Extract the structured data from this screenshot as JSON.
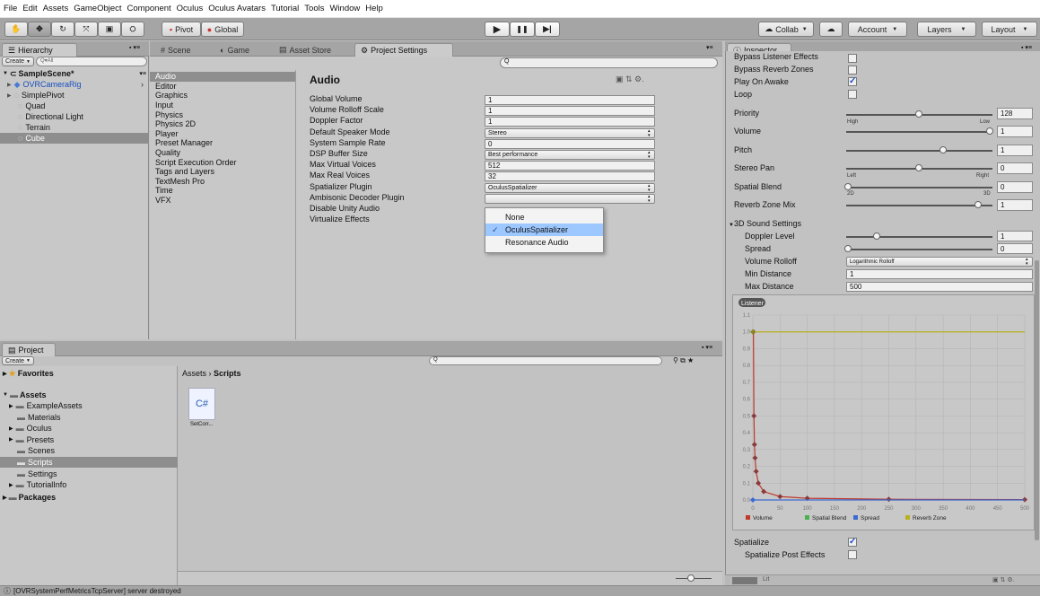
{
  "menu": [
    "File",
    "Edit",
    "Assets",
    "GameObject",
    "Component",
    "Oculus",
    "Oculus Avatars",
    "Tutorial",
    "Tools",
    "Window",
    "Help"
  ],
  "toolbar": {
    "pivot": "Pivot",
    "global": "Global",
    "collab": "Collab",
    "account": "Account",
    "layers": "Layers",
    "layout": "Layout",
    "play": "▶",
    "pause": "❚❚",
    "step": "▶|"
  },
  "hierarchy": {
    "tab": "Hierarchy",
    "create": "Create",
    "search": "Q▾All",
    "scene": "SampleScene*",
    "items": [
      "OVRCameraRig",
      "SimplePivot",
      "Quad",
      "Directional Light",
      "Terrain",
      "Cube"
    ]
  },
  "center_tabs": {
    "scene": "Scene",
    "game": "Game",
    "asset_store": "Asset Store",
    "project_settings": "Project Settings"
  },
  "settings": {
    "categories": [
      "Audio",
      "Editor",
      "Graphics",
      "Input",
      "Physics",
      "Physics 2D",
      "Player",
      "Preset Manager",
      "Quality",
      "Script Execution Order",
      "Tags and Layers",
      "TextMesh Pro",
      "Time",
      "VFX"
    ],
    "title": "Audio",
    "labels": [
      "Global Volume",
      "Volume Rolloff Scale",
      "Doppler Factor",
      "Default Speaker Mode",
      "System Sample Rate",
      "DSP Buffer Size",
      "Max Virtual Voices",
      "Max Real Voices",
      "Spatializer Plugin",
      "Ambisonic Decoder Plugin",
      "Disable Unity Audio",
      "Virtualize Effects"
    ],
    "values": [
      "1",
      "1",
      "1",
      "Stereo",
      "0",
      "Best performance",
      "512",
      "32",
      "OculusSpatializer",
      ""
    ],
    "popup": [
      "None",
      "OculusSpatializer",
      "Resonance Audio"
    ]
  },
  "project": {
    "tab": "Project",
    "create": "Create",
    "favorites": "Favorites",
    "assets": "Assets",
    "breadcrumb_root": "Assets",
    "breadcrumb_leaf": "Scripts",
    "tree": [
      "ExampleAssets",
      "Materials",
      "Oculus",
      "Presets",
      "Scenes",
      "Scripts",
      "Settings",
      "TutorialInfo"
    ],
    "packages": "Packages",
    "file_icon": "C#",
    "file_name": "SetCorr..."
  },
  "inspector": {
    "tab": "Inspector",
    "top": [
      "Bypass Listener Effects",
      "Bypass Reverb Zones",
      "Play On Awake",
      "Loop"
    ],
    "priority": "Priority",
    "priority_val": "128",
    "high": "High",
    "low": "Low",
    "volume": "Volume",
    "volume_val": "1",
    "pitch": "Pitch",
    "pitch_val": "1",
    "stereo_pan": "Stereo Pan",
    "stereo_val": "0",
    "left": "Left",
    "right": "Right",
    "spatial_blend": "Spatial Blend",
    "spatial_val": "0",
    "d2": "2D",
    "d3": "3D",
    "reverb": "Reverb Zone Mix",
    "reverb_val": "1",
    "sound3d": "3D Sound Settings",
    "doppler": "Doppler Level",
    "doppler_val": "1",
    "spread": "Spread",
    "spread_val": "0",
    "rolloff": "Volume Rolloff",
    "rolloff_val": "Logarithmic Rolloff",
    "min_dist": "Min Distance",
    "min_val": "1",
    "max_dist": "Max Distance",
    "max_val": "500",
    "listener": "Listener",
    "spatialize": "Spatialize",
    "spatialize_post": "Spatialize Post Effects",
    "footer": "Lit"
  },
  "chart_data": {
    "type": "line",
    "y_ticks": [
      "1.1",
      "1.0",
      "0.9",
      "0.8",
      "0.7",
      "0.6",
      "0.5",
      "0.4",
      "0.3",
      "0.2",
      "0.1",
      "0.0"
    ],
    "x_ticks": [
      "0",
      "50",
      "100",
      "150",
      "200",
      "250",
      "300",
      "350",
      "400",
      "450",
      "500"
    ],
    "xlim": [
      0,
      500
    ],
    "ylim": [
      0,
      1.1
    ],
    "legend": [
      "Volume",
      "Spatial Blend",
      "Spread",
      "Reverb Zone"
    ],
    "series": [
      {
        "name": "Volume",
        "color": "#c0392b",
        "x": [
          1,
          2,
          3,
          4,
          6,
          10,
          20,
          50,
          100,
          250,
          500
        ],
        "y": [
          1.0,
          0.5,
          0.33,
          0.25,
          0.17,
          0.1,
          0.05,
          0.02,
          0.01,
          0.004,
          0.002
        ]
      },
      {
        "name": "Reverb Zone",
        "color": "#b8b020",
        "x": [
          0,
          500
        ],
        "y": [
          1.0,
          1.0
        ]
      },
      {
        "name": "Spread",
        "color": "#3b6bd1",
        "x": [
          0,
          500
        ],
        "y": [
          0,
          0
        ]
      }
    ]
  },
  "status": "[OVRSystemPerfMetricsTcpServer] server destroyed",
  "colors": {
    "selection": "#8e8e8e",
    "popup_highlight": "#9cc7ff",
    "volume": "#c0392b",
    "spatial": "#4caf50",
    "spread": "#3b6bd1",
    "reverb": "#b8b020"
  }
}
